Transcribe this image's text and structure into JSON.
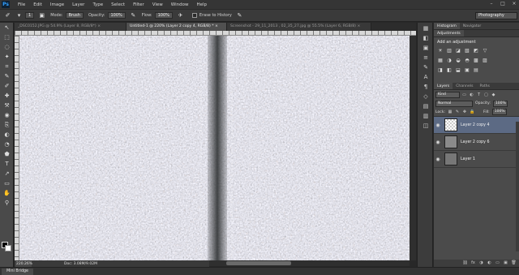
{
  "app": {
    "logo": "Ps"
  },
  "menu": [
    "File",
    "Edit",
    "Image",
    "Layer",
    "Type",
    "Select",
    "Filter",
    "View",
    "Window",
    "Help"
  ],
  "window_controls": [
    "–",
    "□",
    "×"
  ],
  "options_bar": {
    "brush_size": "1",
    "mode_label": "Mode:",
    "mode_value": "Brush",
    "opacity_label": "Opacity:",
    "opacity_value": "100%",
    "flow_label": "Flow:",
    "flow_value": "100%",
    "erase_history_label": "Erase to History",
    "workspace": "Photography"
  },
  "tabs": [
    {
      "label": "_DSC0152.JPG @ 54.9% (Layer 8, RGB/8*)",
      "close": "×",
      "active": false
    },
    {
      "label": "Untitled-1 @ 220% (Layer 2 copy 4, RGB/8) *",
      "close": "×",
      "active": true
    },
    {
      "label": "Screenshot - 29_11_2013 , 02_35_27.jpg @ 55.5% (Layer 6, RGB/8)",
      "close": "×",
      "active": false
    }
  ],
  "tools": [
    "↖",
    "⬚",
    "◌",
    "✦",
    "⌗",
    "✎",
    "✐",
    "✚",
    "⚒",
    "◉",
    "⎘",
    "◐",
    "◔",
    "⬟",
    "T",
    "↗",
    "▭",
    "✋",
    "⚲"
  ],
  "status": {
    "zoom": "220.26%",
    "doc": "Doc: 3.08M/9.02M"
  },
  "mini_bridge": "Mini Bridge",
  "dock_icons": [
    "▦",
    "◧",
    "▣",
    "≡",
    "✎",
    "A",
    "¶",
    "◇",
    "▤",
    "▥",
    "◫"
  ],
  "panels": {
    "top_tabs": [
      "Histogram",
      "Navigator"
    ],
    "adjustments_tab": "Adjustments",
    "adjustments_title": "Add an adjustment",
    "adjustment_row1": [
      "☀",
      "▥",
      "◪",
      "▧",
      "◩",
      "▽"
    ],
    "adjustment_row2": [
      "▦",
      "◑",
      "◒",
      "◓",
      "▩",
      "▨"
    ],
    "adjustment_row3": [
      "◨",
      "◧",
      "⬓",
      "▣",
      "▤"
    ],
    "layer_tabs": [
      "Layers",
      "Channels",
      "Paths"
    ],
    "kind_value": "Kind",
    "filter_icons": [
      "▭",
      "◐",
      "T",
      "▢",
      "◆"
    ],
    "blend_mode": "Normal",
    "opacity_label": "Opacity:",
    "opacity_value": "100%",
    "lock_label": "Lock:",
    "lock_icons": [
      "▦",
      "✎",
      "✥",
      "🔒"
    ],
    "fill_label": "Fill:",
    "fill_value": "100%",
    "layers": [
      {
        "name": "Layer 2 copy 4",
        "eye": "◉",
        "selected": true,
        "thumb": "checker"
      },
      {
        "name": "Layer 2 copy 6",
        "eye": "◉",
        "selected": false,
        "thumb": "stone"
      },
      {
        "name": "Layer 1",
        "eye": "◉",
        "selected": false,
        "thumb": "plain"
      }
    ],
    "footer_icons": [
      "⛓",
      "fx",
      "◑",
      "◐",
      "▭",
      "▣",
      "🗑"
    ]
  }
}
